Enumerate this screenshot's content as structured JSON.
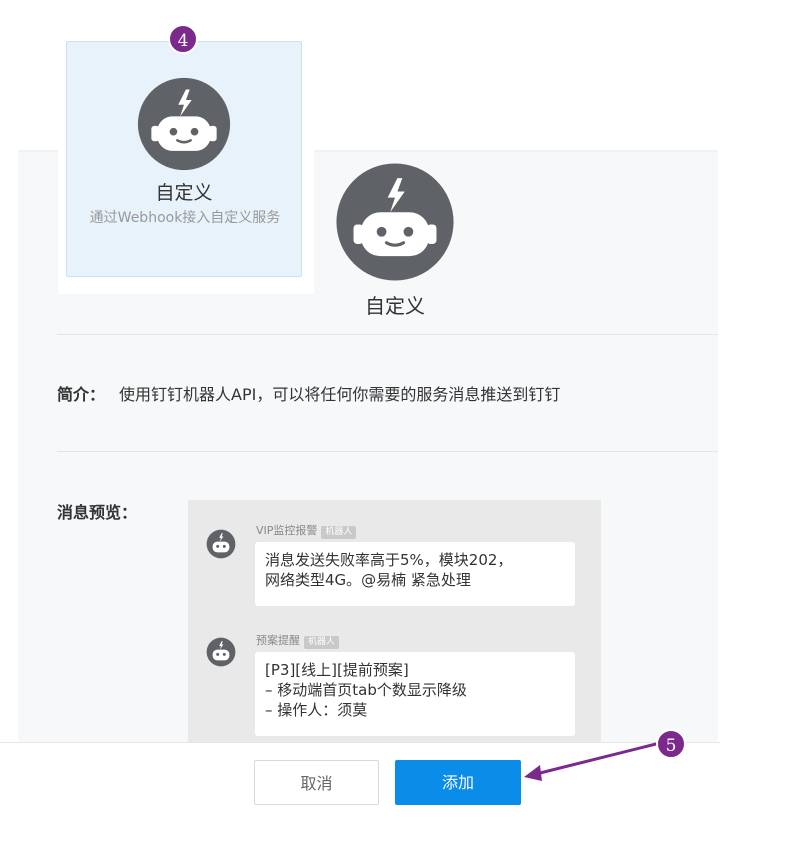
{
  "card": {
    "title": "自定义",
    "description": "通过Webhook接入自定义服务",
    "icon": "robot-icon"
  },
  "annotations": {
    "step_card": "4",
    "step_add": "5",
    "color": "#7b2a8c"
  },
  "detail": {
    "title": "自定义",
    "icon": "robot-icon",
    "intro_label": "简介：",
    "intro_text": "使用钉钉机器人API，可以将任何你需要的服务消息推送到钉钉",
    "preview_label": "消息预览："
  },
  "preview": {
    "messages": [
      {
        "sender": "VIP监控报警",
        "tag": "机器人",
        "lines": [
          "消息发送失败率高于5%，模块202，",
          "网络类型4G。@易楠 紧急处理"
        ]
      },
      {
        "sender": "预案提醒",
        "tag": "机器人",
        "lines": [
          "[P3][线上][提前预案]",
          "– 移动端首页tab个数显示降级",
          "– 操作人：须莫"
        ]
      }
    ]
  },
  "footer": {
    "cancel_label": "取消",
    "add_label": "添加"
  },
  "colors": {
    "primary": "#0a8ce9",
    "robot": "#5f6266",
    "card_bg": "#e8f2fb"
  }
}
